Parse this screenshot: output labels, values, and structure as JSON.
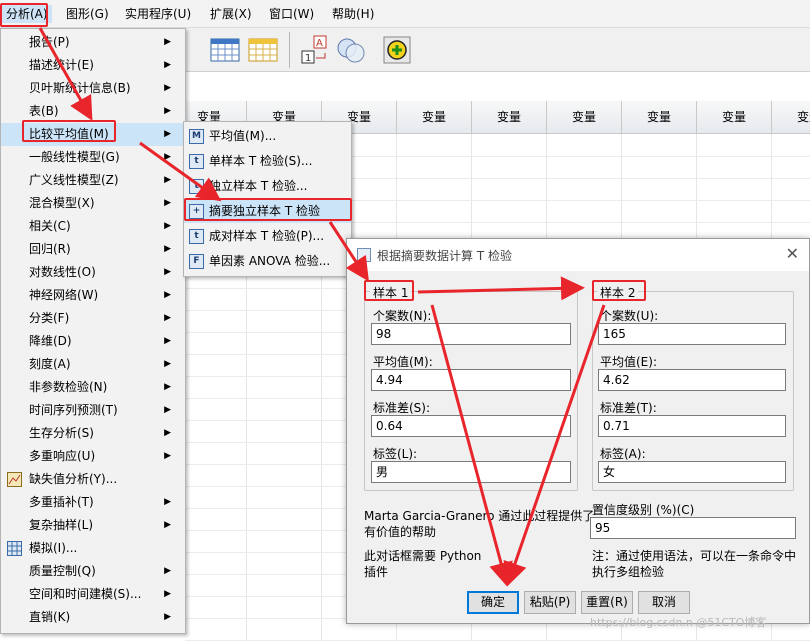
{
  "menubar": [
    {
      "label": "分析(A)",
      "active": true
    },
    {
      "label": "图形(G)"
    },
    {
      "label": "实用程序(U)"
    },
    {
      "label": "扩展(X)"
    },
    {
      "label": "窗口(W)"
    },
    {
      "label": "帮助(H)"
    }
  ],
  "grid": {
    "column_header": "变量"
  },
  "analyze_menu": [
    {
      "label": "报告(P)",
      "submenu": true
    },
    {
      "label": "描述统计(E)",
      "submenu": true
    },
    {
      "label": "贝叶斯统计信息(B)",
      "submenu": true
    },
    {
      "label": "表(B)",
      "submenu": true
    },
    {
      "label": "比较平均值(M)",
      "submenu": true,
      "highlighted": true
    },
    {
      "label": "一般线性模型(G)",
      "submenu": true
    },
    {
      "label": "广义线性模型(Z)",
      "submenu": true
    },
    {
      "label": "混合模型(X)",
      "submenu": true
    },
    {
      "label": "相关(C)",
      "submenu": true
    },
    {
      "label": "回归(R)",
      "submenu": true
    },
    {
      "label": "对数线性(O)",
      "submenu": true
    },
    {
      "label": "神经网络(W)",
      "submenu": true
    },
    {
      "label": "分类(F)",
      "submenu": true
    },
    {
      "label": "降维(D)",
      "submenu": true
    },
    {
      "label": "刻度(A)",
      "submenu": true
    },
    {
      "label": "非参数检验(N)",
      "submenu": true
    },
    {
      "label": "时间序列预测(T)",
      "submenu": true
    },
    {
      "label": "生存分析(S)",
      "submenu": true
    },
    {
      "label": "多重响应(U)",
      "submenu": true
    },
    {
      "label": "缺失值分析(Y)...",
      "submenu": false,
      "icon": "missing-value-icon"
    },
    {
      "label": "多重插补(T)",
      "submenu": true
    },
    {
      "label": "复杂抽样(L)",
      "submenu": true
    },
    {
      "label": "模拟(I)...",
      "submenu": false,
      "icon": "simulation-icon"
    },
    {
      "label": "质量控制(Q)",
      "submenu": true
    },
    {
      "label": "空间和时间建模(S)...",
      "submenu": true
    },
    {
      "label": "直销(K)",
      "submenu": true
    }
  ],
  "compare_means_submenu": [
    {
      "label": "平均值(M)...",
      "icon": "M"
    },
    {
      "label": "单样本 T 检验(S)...",
      "icon": "t"
    },
    {
      "label": "独立样本 T 检验...",
      "icon": "t"
    },
    {
      "label": "摘要独立样本 T 检验",
      "icon": "+",
      "highlighted": true
    },
    {
      "label": "成对样本 T 检验(P)...",
      "icon": "t"
    },
    {
      "label": "单因素 ANOVA 检验...",
      "icon": "F"
    }
  ],
  "dialog": {
    "title": "根据摘要数据计算 T 检验",
    "sample1": {
      "legend": "样本 1",
      "n_label": "个案数(N):",
      "n_value": "98",
      "mean_label": "平均值(M):",
      "mean_value": "4.94",
      "sd_label": "标准差(S):",
      "sd_value": "0.64",
      "tag_label": "标签(L):",
      "tag_value": "男"
    },
    "sample2": {
      "legend": "样本 2",
      "n_label": "个案数(U):",
      "n_value": "165",
      "mean_label": "平均值(E):",
      "mean_value": "4.62",
      "sd_label": "标准差(T):",
      "sd_value": "0.71",
      "tag_label": "标签(A):",
      "tag_value": "女"
    },
    "credit_line1": "Marta Garcia-Granero 通过此过程提供了",
    "credit_line2": "有价值的帮助",
    "python_line1": "此对话框需要 Python",
    "python_line2": "插件",
    "confidence_label": "置信度级别 (%)(C)",
    "confidence_value": "95",
    "note_line1": "注：通过使用语法，可以在一条命令中",
    "note_line2": "执行多组检验",
    "buttons": {
      "ok": "确定",
      "paste": "粘贴(P)",
      "reset": "重置(R)",
      "cancel": "取消"
    }
  },
  "watermark": "https://blog.csdn.n @51CTO博客",
  "colors": {
    "highlight_box": "#e8252b",
    "arrow": "#e8252b",
    "menu_highlight": "#cce4f7"
  }
}
